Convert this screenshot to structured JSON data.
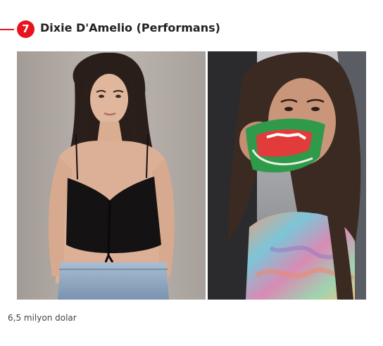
{
  "item": {
    "rank": "7",
    "title": "Dixie D'Amelio (Performans)",
    "caption": "6,5 milyon dolar"
  },
  "colors": {
    "accent": "#e5141f",
    "title_text": "#222222",
    "caption_text": "#444444"
  },
  "photo": {
    "left_panel": "portrait-black-crop-top",
    "right_panel": "car-selfie-with-candy-bag"
  }
}
